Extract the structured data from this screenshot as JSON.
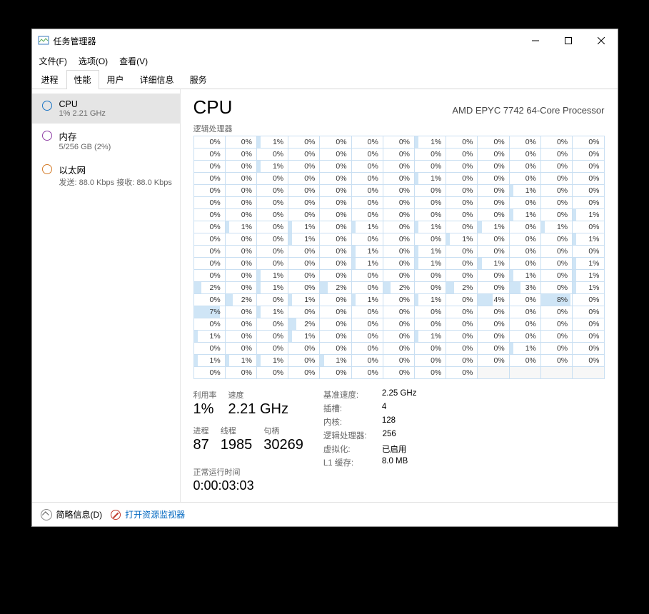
{
  "window": {
    "title": "任务管理器"
  },
  "menu": {
    "file": "文件(F)",
    "options": "选项(O)",
    "view": "查看(V)"
  },
  "tabs": [
    "进程",
    "性能",
    "用户",
    "详细信息",
    "服务"
  ],
  "tabs_active": 1,
  "sidebar": [
    {
      "icon": "blue",
      "title": "CPU",
      "sub": "1% 2.21 GHz",
      "selected": true
    },
    {
      "icon": "purple",
      "title": "内存",
      "sub": "5/256 GB (2%)",
      "selected": false
    },
    {
      "icon": "orange",
      "title": "以太网",
      "sub": "发送: 88.0 Kbps 接收: 88.0 Kbps",
      "selected": false
    }
  ],
  "header": {
    "title": "CPU",
    "name": "AMD EPYC 7742 64-Core Processor",
    "graph_label": "逻辑处理器"
  },
  "chart_data": {
    "type": "heatmap",
    "cols": 13,
    "rows": 20,
    "total_cores": 256,
    "values": [
      [
        0,
        0,
        1,
        0,
        0,
        0,
        0,
        1,
        0,
        0,
        0,
        0,
        0
      ],
      [
        0,
        0,
        0,
        0,
        0,
        0,
        0,
        0,
        0,
        0,
        0,
        0,
        0
      ],
      [
        0,
        0,
        1,
        0,
        0,
        0,
        0,
        0,
        0,
        0,
        0,
        0,
        0
      ],
      [
        0,
        0,
        0,
        0,
        0,
        0,
        0,
        1,
        0,
        0,
        0,
        0,
        0
      ],
      [
        0,
        0,
        0,
        0,
        0,
        0,
        0,
        0,
        0,
        0,
        1,
        0,
        0
      ],
      [
        0,
        0,
        0,
        0,
        0,
        0,
        0,
        0,
        0,
        0,
        0,
        0,
        0
      ],
      [
        0,
        0,
        0,
        0,
        0,
        0,
        0,
        0,
        0,
        0,
        1,
        0,
        1
      ],
      [
        0,
        1,
        0,
        1,
        0,
        1,
        0,
        1,
        0,
        1,
        0,
        1,
        0
      ],
      [
        0,
        0,
        0,
        1,
        0,
        0,
        0,
        0,
        1,
        0,
        0,
        0,
        1
      ],
      [
        0,
        0,
        0,
        0,
        0,
        1,
        0,
        1,
        0,
        0,
        0,
        0,
        0
      ],
      [
        0,
        0,
        0,
        0,
        0,
        1,
        0,
        1,
        0,
        1,
        0,
        0,
        1
      ],
      [
        0,
        0,
        1,
        0,
        0,
        0,
        0,
        0,
        0,
        0,
        1,
        0,
        1
      ],
      [
        2,
        0,
        1,
        0,
        2,
        0,
        2,
        0,
        2,
        0,
        3,
        0,
        1
      ],
      [
        0,
        2,
        0,
        1,
        0,
        1,
        0,
        1,
        0,
        4,
        0,
        8,
        0
      ],
      [
        7,
        0,
        1,
        0,
        0,
        0,
        0,
        0,
        0,
        0,
        0,
        0,
        0
      ],
      [
        0,
        0,
        0,
        2,
        0,
        0,
        0,
        0,
        0,
        0,
        0,
        0,
        0
      ],
      [
        1,
        0,
        0,
        1,
        0,
        0,
        0,
        1,
        0,
        0,
        0,
        0,
        0
      ],
      [
        0,
        0,
        0,
        0,
        0,
        0,
        0,
        0,
        0,
        0,
        1,
        0,
        0
      ],
      [
        1,
        1,
        1,
        0,
        1,
        0,
        0,
        0,
        0,
        0,
        0,
        0,
        0
      ],
      [
        0,
        0,
        0,
        0,
        0,
        0,
        0,
        0,
        0,
        null,
        null,
        null,
        null
      ]
    ]
  },
  "stats": {
    "utilization": {
      "label": "利用率",
      "value": "1%"
    },
    "speed": {
      "label": "速度",
      "value": "2.21 GHz"
    },
    "processes": {
      "label": "进程",
      "value": "87"
    },
    "threads": {
      "label": "线程",
      "value": "1985"
    },
    "handles": {
      "label": "句柄",
      "value": "30269"
    },
    "uptime": {
      "label": "正常运行时间",
      "value": "0:00:03:03"
    }
  },
  "specs": {
    "base_speed": {
      "label": "基准速度:",
      "value": "2.25 GHz"
    },
    "sockets": {
      "label": "插槽:",
      "value": "4"
    },
    "cores": {
      "label": "内核:",
      "value": "128"
    },
    "logical": {
      "label": "逻辑处理器:",
      "value": "256"
    },
    "virtualization": {
      "label": "虚拟化:",
      "value": "已启用"
    },
    "l1": {
      "label": "L1 缓存:",
      "value": "8.0 MB"
    }
  },
  "footer": {
    "collapse": "简略信息(D)",
    "link": "打开资源监视器"
  }
}
